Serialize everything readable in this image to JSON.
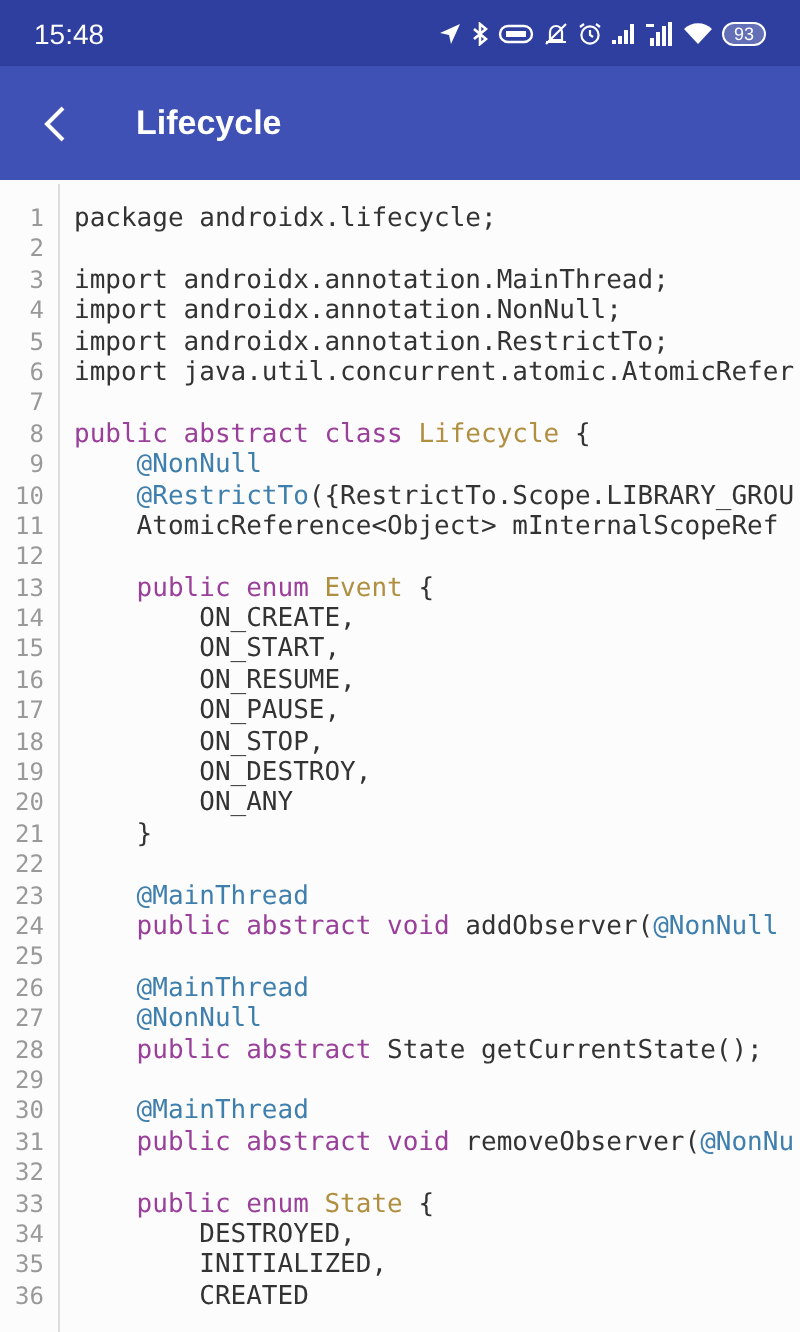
{
  "status_bar": {
    "time": "15:48",
    "battery": "93"
  },
  "toolbar": {
    "title": "Lifecycle"
  },
  "code": {
    "lines": [
      {
        "number": "1",
        "tokens": [
          {
            "text": "package androidx.lifecycle;",
            "kind": "plain"
          }
        ]
      },
      {
        "number": "2"
      },
      {
        "number": "3",
        "tokens": [
          {
            "text": "import androidx.annotation.MainThread;",
            "kind": "plain"
          }
        ]
      },
      {
        "number": "4",
        "tokens": [
          {
            "text": "import androidx.annotation.NonNull;",
            "kind": "plain"
          }
        ]
      },
      {
        "number": "5",
        "tokens": [
          {
            "text": "import androidx.annotation.RestrictTo;",
            "kind": "plain"
          }
        ]
      },
      {
        "number": "6",
        "tokens": [
          {
            "text": "import java.util.concurrent.atomic.AtomicRefer",
            "kind": "plain"
          }
        ]
      },
      {
        "number": "7"
      },
      {
        "number": "8",
        "tokens": [
          {
            "text": "public abstract class ",
            "kind": "keyword"
          },
          {
            "text": "Lifecycle",
            "kind": "type"
          },
          {
            "text": " {",
            "kind": "plain"
          }
        ]
      },
      {
        "number": "9",
        "tokens": [
          {
            "text": "    @NonNull",
            "kind": "annotation"
          }
        ]
      },
      {
        "number": "10",
        "tokens": [
          {
            "text": "    @RestrictTo",
            "kind": "annotation"
          },
          {
            "text": "({RestrictTo.Scope.LIBRARY_GROU",
            "kind": "plain"
          }
        ]
      },
      {
        "number": "11",
        "tokens": [
          {
            "text": "    AtomicReference<Object> mInternalScopeRef",
            "kind": "plain"
          }
        ]
      },
      {
        "number": "12"
      },
      {
        "number": "13",
        "tokens": [
          {
            "text": "    public enum ",
            "kind": "keyword"
          },
          {
            "text": "Event",
            "kind": "type"
          },
          {
            "text": " {",
            "kind": "plain"
          }
        ]
      },
      {
        "number": "14",
        "tokens": [
          {
            "text": "        ON_CREATE,",
            "kind": "plain"
          }
        ]
      },
      {
        "number": "15",
        "tokens": [
          {
            "text": "        ON_START,",
            "kind": "plain"
          }
        ]
      },
      {
        "number": "16",
        "tokens": [
          {
            "text": "        ON_RESUME,",
            "kind": "plain"
          }
        ]
      },
      {
        "number": "17",
        "tokens": [
          {
            "text": "        ON_PAUSE,",
            "kind": "plain"
          }
        ]
      },
      {
        "number": "18",
        "tokens": [
          {
            "text": "        ON_STOP,",
            "kind": "plain"
          }
        ]
      },
      {
        "number": "19",
        "tokens": [
          {
            "text": "        ON_DESTROY,",
            "kind": "plain"
          }
        ]
      },
      {
        "number": "20",
        "tokens": [
          {
            "text": "        ON_ANY",
            "kind": "plain"
          }
        ]
      },
      {
        "number": "21",
        "tokens": [
          {
            "text": "    }",
            "kind": "plain"
          }
        ]
      },
      {
        "number": "22"
      },
      {
        "number": "23",
        "tokens": [
          {
            "text": "    @MainThread",
            "kind": "annotation"
          }
        ]
      },
      {
        "number": "24",
        "tokens": [
          {
            "text": "    public abstract void ",
            "kind": "keyword"
          },
          {
            "text": "addObserver(",
            "kind": "plain"
          },
          {
            "text": "@NonNull",
            "kind": "annotation"
          }
        ]
      },
      {
        "number": "25"
      },
      {
        "number": "26",
        "tokens": [
          {
            "text": "    @MainThread",
            "kind": "annotation"
          }
        ]
      },
      {
        "number": "27",
        "tokens": [
          {
            "text": "    @NonNull",
            "kind": "annotation"
          }
        ]
      },
      {
        "number": "28",
        "tokens": [
          {
            "text": "    public abstract ",
            "kind": "keyword"
          },
          {
            "text": "State getCurrentState();",
            "kind": "plain"
          }
        ]
      },
      {
        "number": "29"
      },
      {
        "number": "30",
        "tokens": [
          {
            "text": "    @MainThread",
            "kind": "annotation"
          }
        ]
      },
      {
        "number": "31",
        "tokens": [
          {
            "text": "    public abstract void ",
            "kind": "keyword"
          },
          {
            "text": "removeObserver(",
            "kind": "plain"
          },
          {
            "text": "@NonNu",
            "kind": "annotation"
          }
        ]
      },
      {
        "number": "32"
      },
      {
        "number": "33",
        "tokens": [
          {
            "text": "    public enum ",
            "kind": "keyword"
          },
          {
            "text": "State",
            "kind": "type"
          },
          {
            "text": " {",
            "kind": "plain"
          }
        ]
      },
      {
        "number": "34",
        "tokens": [
          {
            "text": "        DESTROYED,",
            "kind": "plain"
          }
        ]
      },
      {
        "number": "35",
        "tokens": [
          {
            "text": "        INITIALIZED,",
            "kind": "plain"
          }
        ]
      },
      {
        "number": "36",
        "tokens": [
          {
            "text": "        CREATED",
            "kind": "plain"
          }
        ]
      }
    ]
  }
}
